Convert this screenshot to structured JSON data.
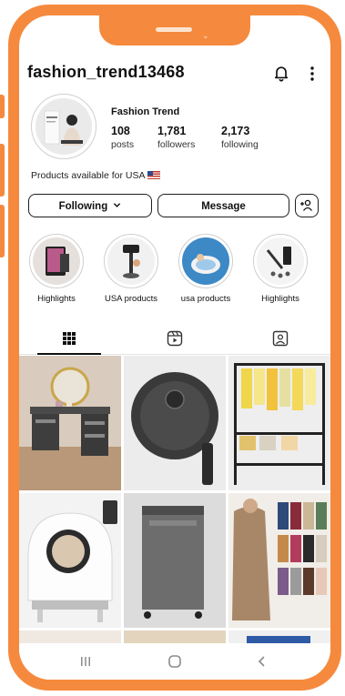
{
  "profile": {
    "username": "fashion_trend13468",
    "display_name": "Fashion Trend",
    "stats": [
      {
        "value": "108",
        "label": "posts"
      },
      {
        "value": "1,781",
        "label": "followers"
      },
      {
        "value": "2,173",
        "label": "following"
      }
    ],
    "bio": "Products available for USA",
    "bio_flag_icon": "us-flag-icon"
  },
  "actions": {
    "following_label": "Following",
    "message_label": "Message",
    "add_user_icon": "add-user-icon"
  },
  "highlights": [
    {
      "label": "Highlights"
    },
    {
      "label": "USA products"
    },
    {
      "label": "usa products"
    },
    {
      "label": "Highlights"
    }
  ],
  "tabs": [
    {
      "icon": "grid-icon",
      "active": true
    },
    {
      "icon": "reels-icon",
      "active": false
    },
    {
      "icon": "tagged-icon",
      "active": false
    }
  ],
  "posts": [
    "vanity-desk",
    "robot-vacuum",
    "clothing-rack",
    "cat-litter-box",
    "laundry-hamper",
    "cardigan-sweaters"
  ],
  "system_nav": [
    "recent-apps-icon",
    "home-icon",
    "back-icon"
  ],
  "colors": {
    "frame": "#f58a3e",
    "text": "#111111"
  }
}
